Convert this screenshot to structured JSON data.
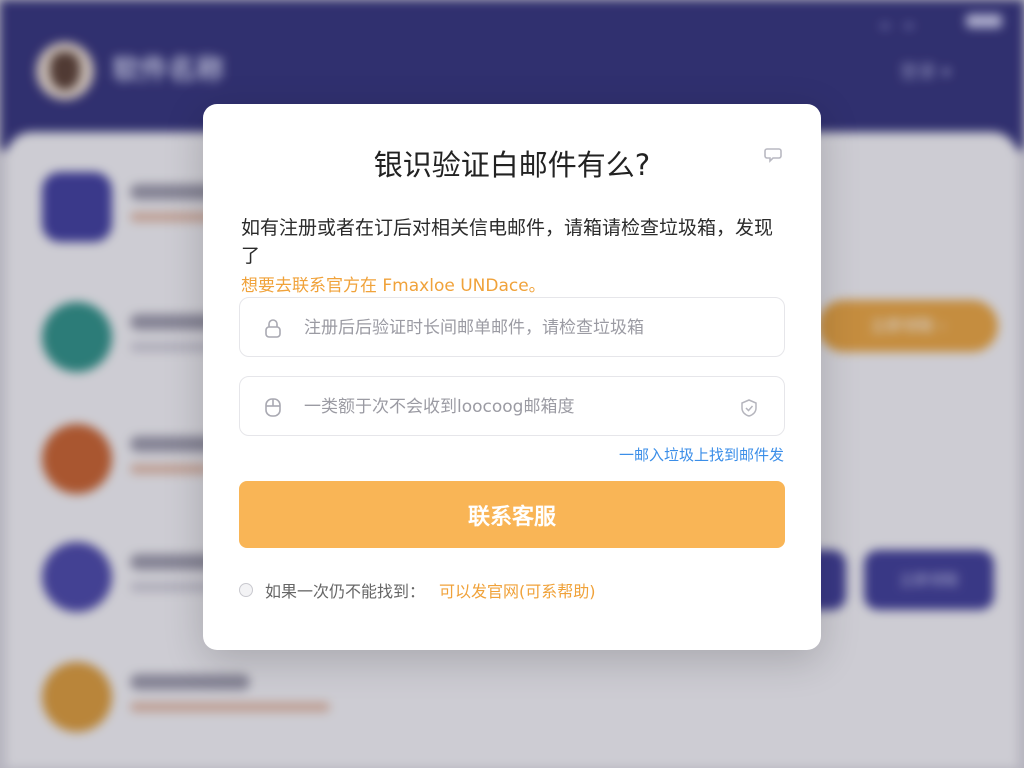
{
  "colors": {
    "header_bg": "#33327a",
    "accent_orange": "#f9b556",
    "highlight_text": "#f0a23a",
    "link_blue": "#3b8ee8"
  },
  "background": {
    "header": {
      "brand": "软件名称",
      "top_right": "登录 ▾"
    },
    "rows": [
      {
        "color": "#3f3d9c",
        "icon": "rocket-icon"
      },
      {
        "color": "#2e8f85",
        "icon": "shirt-icon"
      },
      {
        "color": "#c6612e",
        "icon": "heart-icon"
      },
      {
        "color": "#4a47a6",
        "icon": "shield-icon"
      },
      {
        "color": "#d99a3a",
        "icon": "coin-icon"
      }
    ],
    "buttons": {
      "orange_pill": "立即领取 ›",
      "purple_btn": "立即领取"
    }
  },
  "modal": {
    "title": "银识验证白邮件有么?",
    "description": "如有注册或者在订后对相关信电邮件，请箱请检查垃圾箱，发现了",
    "description_highlight": "想要去联系官方在 Fmaxloe UNDace。",
    "field_1": {
      "icon": "lock-icon",
      "placeholder": "注册后后验证时长间邮单邮件，请检查垃圾箱"
    },
    "field_2": {
      "icon": "mouse-icon",
      "placeholder": "一类额于次不会收到loocoog邮箱度",
      "end_icon": "shield-check-icon"
    },
    "link_right": "一邮入垃圾上找到邮件发",
    "primary_button": "联系客服",
    "footer_prefix": "如果一次仍不能找到：",
    "footer_link": "可以发官网(可系帮助)",
    "close_icon": "help-bubble-icon"
  }
}
